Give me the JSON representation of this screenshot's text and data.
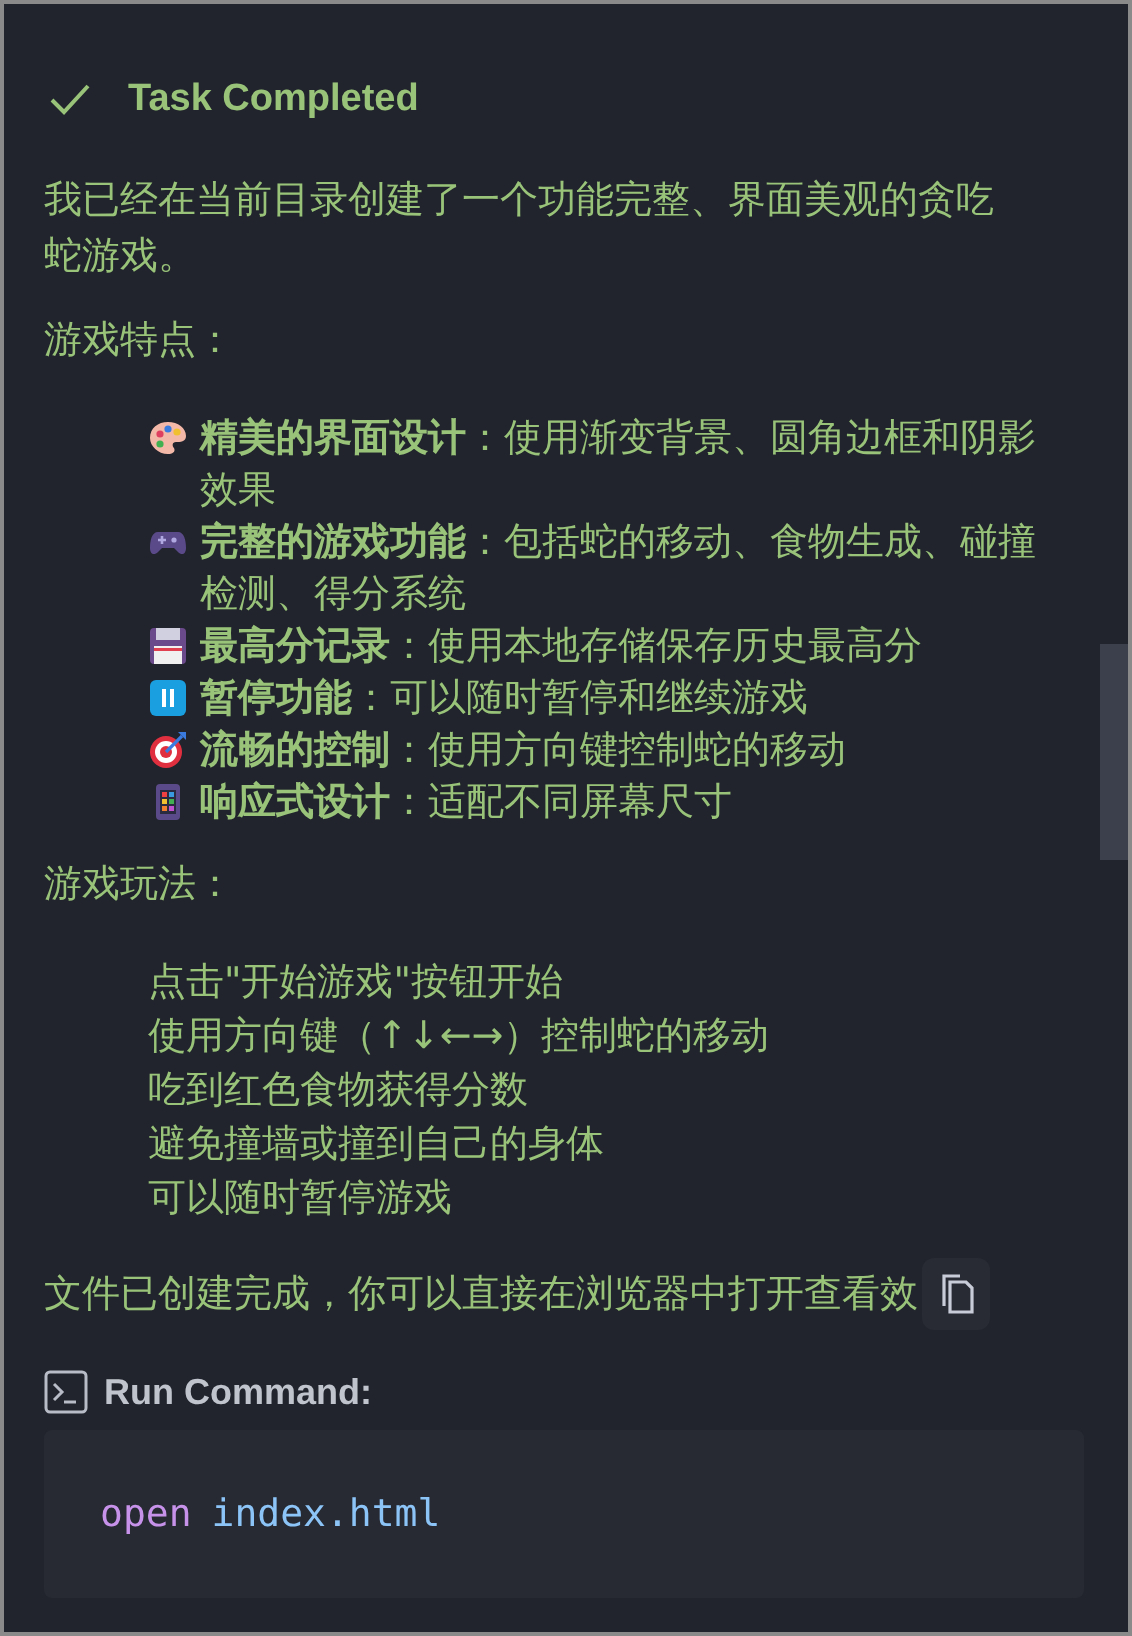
{
  "status": {
    "title": "Task Completed"
  },
  "intro": "我已经在当前目录创建了一个功能完整、界面美观的贪吃蛇游戏。",
  "features_heading": "游戏特点：",
  "features": [
    {
      "kind": "palette",
      "text": "**精美的界面设计**：使用渐变背景、圆角边框和阴影效果"
    },
    {
      "kind": "gamepad",
      "text": "**完整的游戏功能**：包括蛇的移动、食物生成、碰撞检测、得分系统"
    },
    {
      "kind": "floppy",
      "text": "**最高分记录**：使用本地存储保存历史最高分"
    },
    {
      "kind": "pause",
      "text": "**暂停功能**：可以随时暂停和继续游戏"
    },
    {
      "kind": "target",
      "text": "**流畅的控制**：使用方向键控制蛇的移动"
    },
    {
      "kind": "phone",
      "text": "**响应式设计**：适配不同屏幕尺寸"
    }
  ],
  "howto_heading": "游戏玩法：",
  "howto": [
    "点击\"开始游戏\"按钮开始",
    "使用方向键（↑↓←→）控制蛇的移动",
    "吃到红色食物获得分数",
    "避免撞墙或撞到自己的身体",
    "可以随时暂停游戏"
  ],
  "closing": "文件已创建完成，你可以直接在浏览器中打开查看效",
  "run_command": {
    "label": "Run Command:",
    "keyword": "open",
    "argument": "index.html"
  }
}
